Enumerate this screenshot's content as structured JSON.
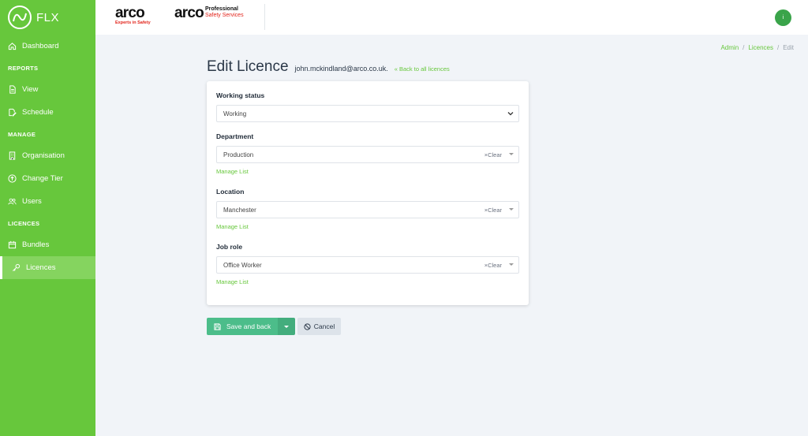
{
  "brand": {
    "name": "FLX"
  },
  "sidebar": {
    "dashboard": "Dashboard",
    "sections": {
      "reports": "REPORTS",
      "manage": "MANAGE",
      "licences": "LICENCES"
    },
    "items": {
      "view": "View",
      "schedule": "Schedule",
      "organisation": "Organisation",
      "change_tier": "Change Tier",
      "users": "Users",
      "bundles": "Bundles",
      "licences": "Licences"
    },
    "active": "licences"
  },
  "header": {
    "logo1": {
      "word": "arco",
      "tagline": "Experts in Safety"
    },
    "logo2": {
      "word": "arco",
      "line1": "Professional",
      "line2": "Safety Services"
    },
    "avatar_initial": "i"
  },
  "breadcrumb": {
    "admin": "Admin",
    "licences": "Licences",
    "current": "Edit",
    "sep": "/"
  },
  "page": {
    "title": "Edit Licence",
    "email": "john.mckindland@arco.co.uk.",
    "back_link": "Back to all licences"
  },
  "form": {
    "working_status": {
      "label": "Working status",
      "value": "Working"
    },
    "department": {
      "label": "Department",
      "value": "Production",
      "clear": "×Clear",
      "manage": "Manage List"
    },
    "location": {
      "label": "Location",
      "value": "Manchester",
      "clear": "×Clear",
      "manage": "Manage List"
    },
    "job_role": {
      "label": "Job role",
      "value": "Office Worker",
      "clear": "×Clear",
      "manage": "Manage List"
    }
  },
  "actions": {
    "save": "Save and back",
    "cancel": "Cancel"
  },
  "colors": {
    "sidebar": "#67c73c",
    "primary": "#4cbd8a",
    "link": "#67c73c",
    "background": "#f1f4f8"
  }
}
